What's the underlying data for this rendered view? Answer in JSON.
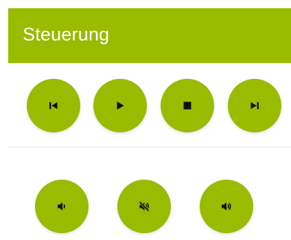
{
  "header": {
    "title": "Steuerung"
  },
  "colors": {
    "accent": "#99bb00",
    "icon": "#111111",
    "background": "#ffffff"
  },
  "transport_controls": [
    {
      "name": "previous",
      "icon": "skip-previous-icon"
    },
    {
      "name": "play",
      "icon": "play-icon"
    },
    {
      "name": "stop",
      "icon": "stop-icon"
    },
    {
      "name": "next",
      "icon": "skip-next-icon"
    }
  ],
  "volume_controls": [
    {
      "name": "volume-down",
      "icon": "volume-down-icon"
    },
    {
      "name": "mute",
      "icon": "volume-mute-icon"
    },
    {
      "name": "volume-up",
      "icon": "volume-up-icon"
    }
  ]
}
